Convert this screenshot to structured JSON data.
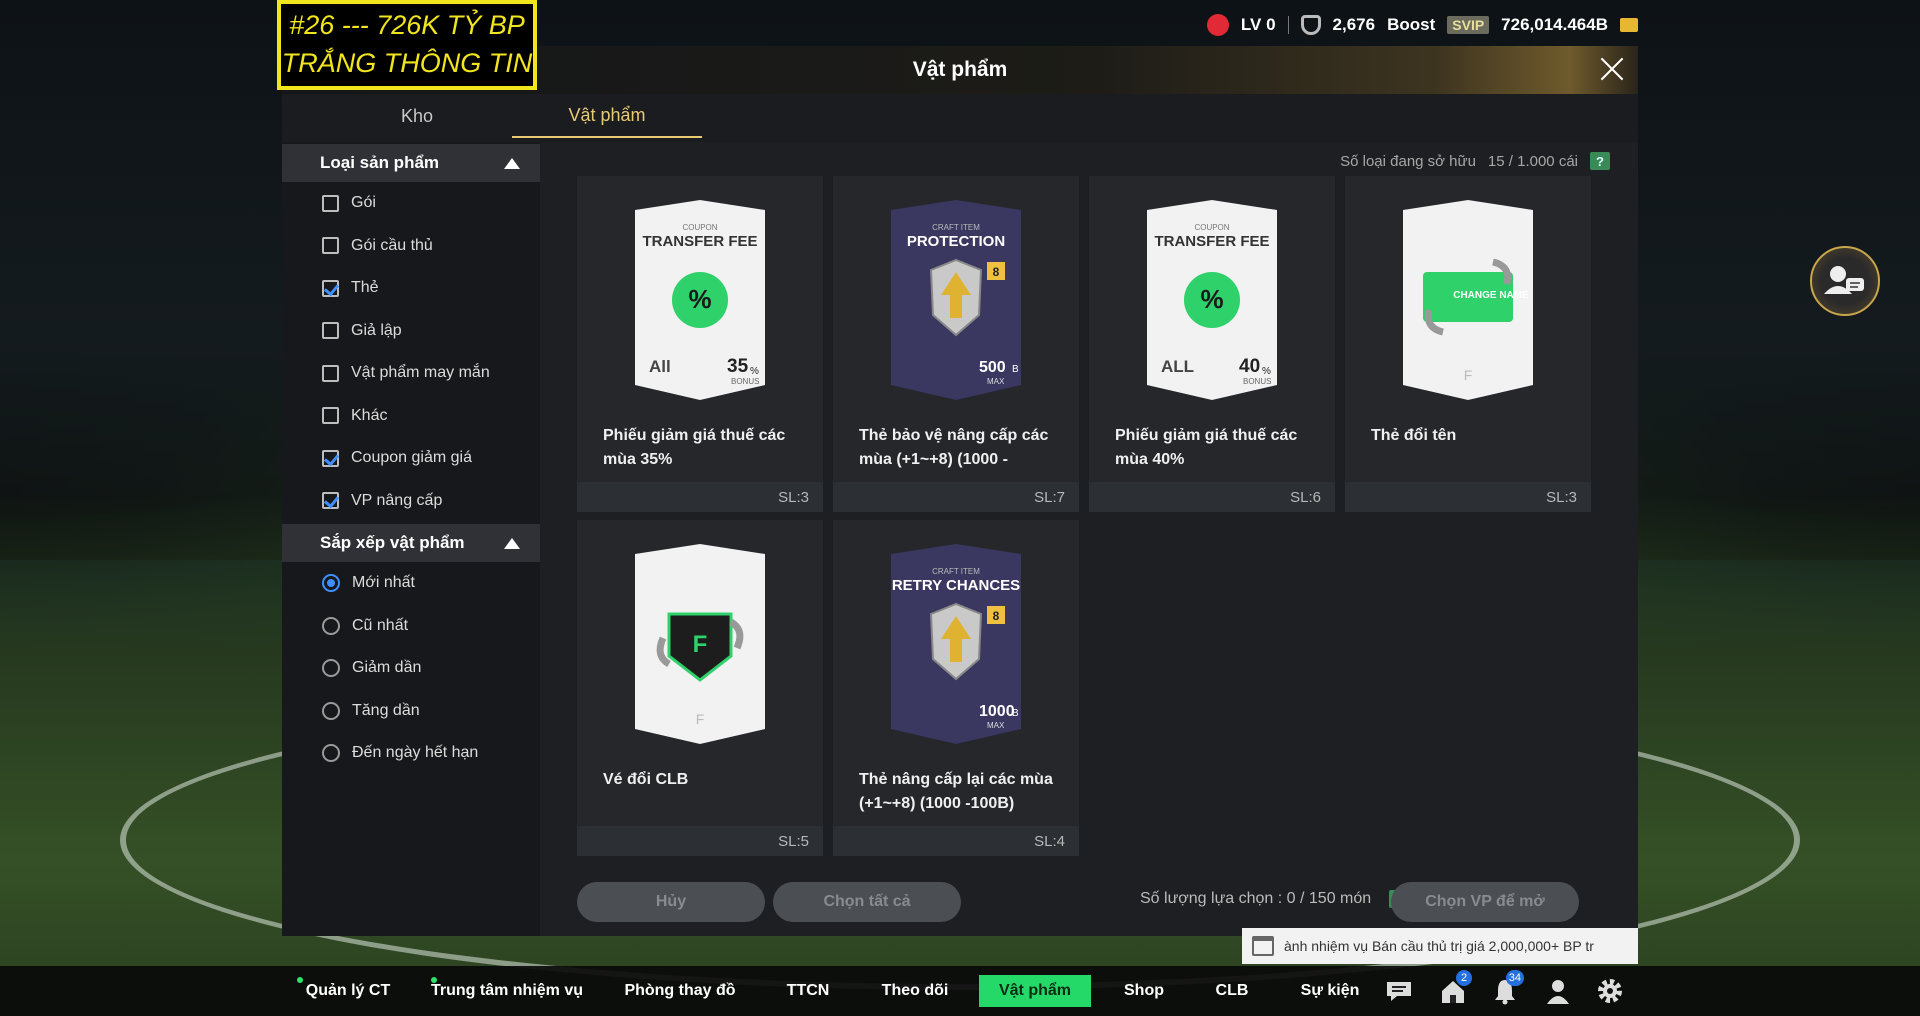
{
  "overlay_caption": {
    "line1": "#26 --- 726K TỶ BP",
    "line2": "TRẮNG THÔNG TIN"
  },
  "topbar": {
    "level": "LV 0",
    "shield_value": "2,676",
    "boost_label": "Boost",
    "svip_label": "SVIP",
    "bp_value": "726,014.464B"
  },
  "modal": {
    "title": "Vật phẩm",
    "tabs": [
      {
        "label": "Kho"
      },
      {
        "label": "Vật phẩm"
      }
    ],
    "active_tab": "Vật phẩm"
  },
  "sidebar": {
    "product_type": {
      "title": "Loại sản phẩm",
      "options": [
        {
          "label": "Gói",
          "checked": false
        },
        {
          "label": "Gói cầu thủ",
          "checked": false
        },
        {
          "label": "Thẻ",
          "checked": true
        },
        {
          "label": "Giả lập",
          "checked": false
        },
        {
          "label": "Vật phẩm may mắn",
          "checked": false
        },
        {
          "label": "Khác",
          "checked": false
        },
        {
          "label": "Coupon giảm giá",
          "checked": true
        },
        {
          "label": "VP nâng cấp",
          "checked": true
        }
      ]
    },
    "sort": {
      "title": "Sắp xếp vật phẩm",
      "options": [
        {
          "label": "Mới nhất",
          "selected": true
        },
        {
          "label": "Cũ nhất",
          "selected": false
        },
        {
          "label": "Giảm dần",
          "selected": false
        },
        {
          "label": "Tăng dần",
          "selected": false
        },
        {
          "label": "Đến ngày hết hạn",
          "selected": false
        }
      ]
    }
  },
  "content": {
    "owned_label": "Số loại đang sở hữu",
    "owned_value": "15 / 1.000 cái",
    "help_label": "?",
    "items": [
      {
        "name": "Phiếu giảm giá thuế các mùa 35%",
        "qty": "SL:3",
        "art": "coupon",
        "art_title_small": "COUPON",
        "art_title": "TRANSFER FEE",
        "art_left": "All",
        "art_right": "35",
        "art_right_suffix": "%",
        "art_right_sub": "BONUS",
        "icon": "percent-coupon-icon"
      },
      {
        "name": "Thẻ bảo vệ nâng cấp các mùa (+1~+8) (1000 -",
        "qty": "SL:7",
        "art": "craft",
        "art_title_small": "CRAFT ITEM",
        "art_title": "PROTECTION",
        "art_right": "500",
        "art_right_suffix": "B",
        "art_right_sub": "MAX",
        "art_badge": "8",
        "icon": "shield-arrow-icon"
      },
      {
        "name": "Phiếu giảm giá thuế các mùa 40%",
        "qty": "SL:6",
        "art": "coupon",
        "art_title_small": "COUPON",
        "art_title": "TRANSFER FEE",
        "art_left": "ALL",
        "art_right": "40",
        "art_right_suffix": "%",
        "art_right_sub": "BONUS",
        "icon": "percent-coupon-icon"
      },
      {
        "name": "Thẻ đổi tên",
        "qty": "SL:3",
        "art": "namechange",
        "art_title": "CHANGE NAME",
        "icon": "name-change-icon"
      },
      {
        "name": "Vé đổi CLB",
        "qty": "SL:5",
        "art": "club",
        "icon": "club-change-icon"
      },
      {
        "name": "Thẻ nâng cấp lại các mùa (+1~+8) (1000 -100B)",
        "qty": "SL:4",
        "art": "craft",
        "art_title_small": "CRAFT ITEM",
        "art_title": "RETRY CHANCES",
        "art_right": "1000",
        "art_right_suffix": "B",
        "art_right_sub": "MAX",
        "art_badge": "8",
        "icon": "retry-arrows-icon"
      }
    ],
    "cancel_label": "Hủy",
    "select_all_label": "Chọn tất cả",
    "selection_label": "Số lượng lựa chọn : 0 / 150 món",
    "open_selected_label": "Chọn VP để mở"
  },
  "notice": {
    "text": "ành nhiệm vụ Bán cầu thủ trị giá 2,000,000+ BP tr"
  },
  "bottom_nav": {
    "items": [
      {
        "label": "Quản lý CT",
        "dot": true
      },
      {
        "label": "Trung tâm nhiệm vụ",
        "dot": true
      },
      {
        "label": "Phòng thay đồ"
      },
      {
        "label": "TTCN"
      },
      {
        "label": "Theo dõi"
      },
      {
        "label": "Vật phẩm",
        "active": true
      },
      {
        "label": "Shop"
      },
      {
        "label": "CLB"
      },
      {
        "label": "Sự kiện"
      }
    ],
    "home_badge": "2",
    "bell_badge": "34"
  },
  "colors": {
    "accent_gold": "#e8c974",
    "nav_active": "#25d968",
    "check_blue": "#3e90ff",
    "caption_yellow": "#f1e61d"
  }
}
